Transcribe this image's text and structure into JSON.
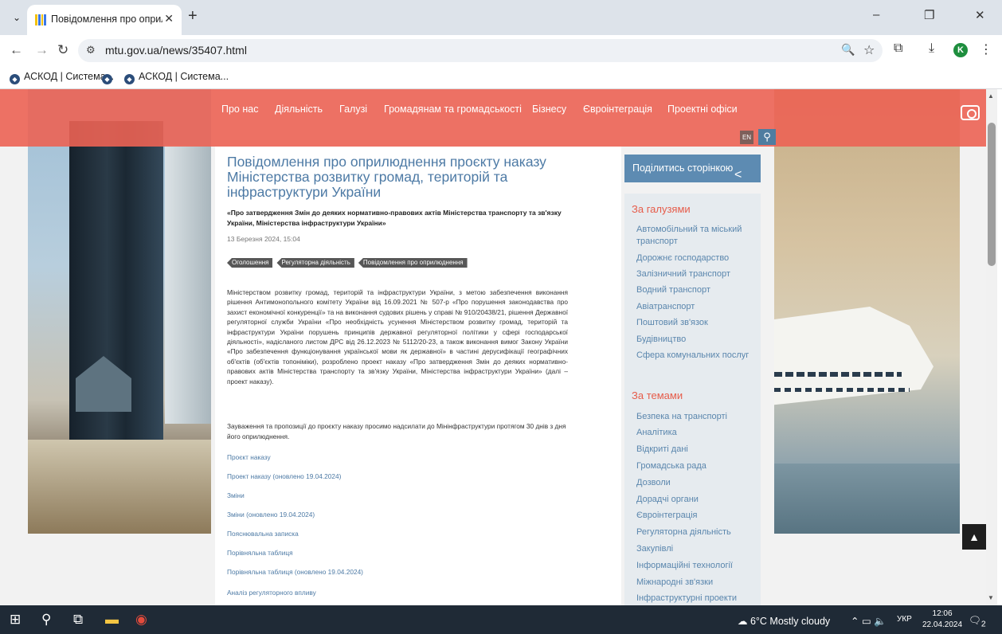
{
  "browser": {
    "tab_title": "Повідомлення про оприлюд",
    "url": "mtu.gov.ua/news/35407.html",
    "avatar_letter": "K",
    "bookmarks": [
      "АСКОД | Система...",
      "АСКОД | Система..."
    ]
  },
  "site": {
    "nav": [
      "Про нас",
      "Діяльність",
      "Галузі",
      "Громадянам та громадськості",
      "Бізнесу",
      "Євроінтеграція",
      "Проектні офіси"
    ],
    "lang_button": "EN"
  },
  "article": {
    "title": "Повідомлення про оприлюднення проєкту наказу Міністерства розвитку громад, територій та інфраструктури України",
    "subtitle": "«Про затвердження Змін до деяких нормативно-правових актів Міністерства транспорту та зв'язку України, Міністерства інфраструктури України»",
    "date": "13 Березня 2024, 15:04",
    "tags": [
      "Оголошення",
      "Регуляторна діяльність",
      "Повідомлення про оприлюднення"
    ],
    "body1": "Міністерством розвитку громад, територій та інфраструктури України, з метою забезпечення виконання рішення Антимонопольного комітету України від 16.09.2021 № 507-р «Про порушення законодавства про захист економічної конкуренції» та на виконання судових рішень у справі № 910/20438/21, рішення Державної регуляторної служби України «Про необхідність усунення Міністерством розвитку громад, територій та інфраструктури України порушень принципів державної регуляторної політики у сфері господарської діяльності», надісланого листом ДРС від 26.12.2023 № 5112/20-23, а також виконання вимог Закону України «Про забезпечення функціонування української мови як державної» в частині дерусифікації географічних об'єктів (об'єктів топоніміки), розроблено проект наказу «Про затвердження Змін до деяких нормативно-правових актів Міністерства транспорту та зв'язку України, Міністерства інфраструктури України» (далі – проект наказу).",
    "body2": "Зауваження та пропозиції до проєкту наказу просимо надсилати до Мінінфраструктури протягом 30 днів з дня його оприлюднення.",
    "links": [
      "Проєкт наказу",
      "Проект наказу (оновлено 19.04.2024)",
      "Зміни",
      "Зміни (оновлено 19.04.2024)",
      "Пояснювальна записка",
      "Порівняльна таблиця",
      "Порівняльна таблиця (оновлено 19.04.2024)",
      "Аналіз регуляторного впливу"
    ]
  },
  "sidebar": {
    "share_label": "Поділитись сторінкою",
    "industries_title": "За галузями",
    "industries": [
      "Автомобільний та міський транспорт",
      "Дорожнє господарство",
      "Залізничний транспорт",
      "Водний транспорт",
      "Авіатранспорт",
      "Поштовий зв'язок",
      "Будівництво",
      "Сфера комунальних послуг"
    ],
    "topics_title": "За темами",
    "topics": [
      "Безпека на транспорті",
      "Аналітика",
      "Відкриті дані",
      "Громадська рада",
      "Дозволи",
      "Дорадчі органи",
      "Євроінтеграція",
      "Регуляторна діяльність",
      "Закупівлі",
      "Інформаційні технології",
      "Міжнародні зв'язки",
      "Інфраструктурні проекти"
    ]
  },
  "taskbar": {
    "weather": "6°C  Mostly cloudy",
    "lang": "УКР",
    "time": "12:06",
    "date": "22.04.2024",
    "notif_count": "2"
  },
  "colors": {
    "nav_bg": "#ec6354",
    "link": "#4d7aa5",
    "sidebar_head": "#e65c4a"
  }
}
